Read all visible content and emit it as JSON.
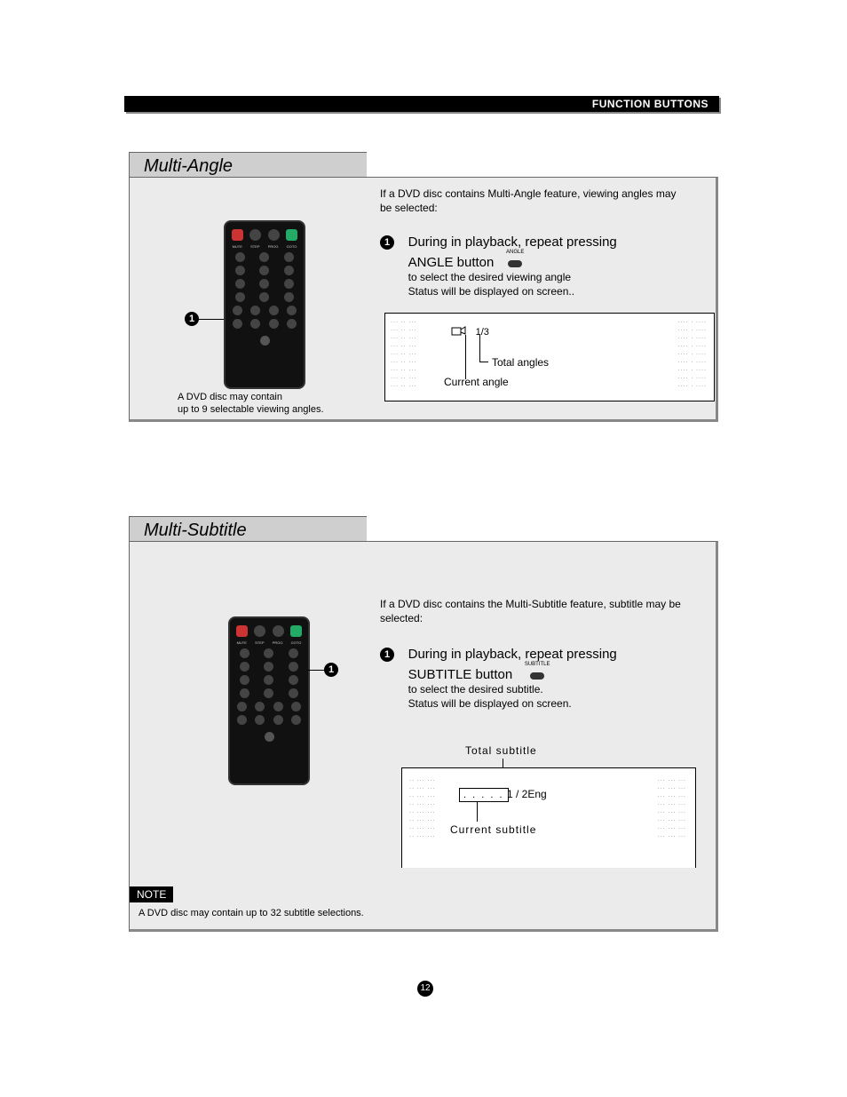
{
  "header": {
    "title": "FUNCTION BUTTONS"
  },
  "sections": {
    "angle": {
      "title": "Multi-Angle",
      "intro": "If a DVD disc contains Multi-Angle feature, viewing angles may  be selected:",
      "step_title_line1": "During in playback, repeat pressing",
      "step_title_line2": "ANGLE button",
      "button_small_label": "ANGLE",
      "step_sub1": "to select the desired viewing angle",
      "step_sub2": "Status will be displayed on screen..",
      "caption_line1": "A DVD disc  may contain",
      "caption_line2": "up to 9 selectable viewing angles.",
      "tv_ratio": "1/3",
      "tv_label_total": "Total angles",
      "tv_label_current": "Current angle"
    },
    "subtitle": {
      "title": "Multi-Subtitle",
      "intro": "If a DVD disc contains the Multi-Subtitle feature, subtitle may be selected:",
      "step_title_line1": "During in playback, repeat pressing",
      "step_title_line2": "SUBTITLE button",
      "button_small_label": "SUBTITLE",
      "step_sub1": "to select the desired subtitle.",
      "step_sub2": "Status will be displayed on screen.",
      "tv_label_total": "Total subtitle",
      "tv_value": "1 / 2Eng",
      "tv_box_dots": ". . . . .",
      "tv_label_current": "Current subtitle",
      "note_label": "NOTE",
      "note_text": "A DVD disc may contain up to 32 subtitle selections."
    }
  },
  "bullets": {
    "one": "1"
  },
  "page_number": "12"
}
